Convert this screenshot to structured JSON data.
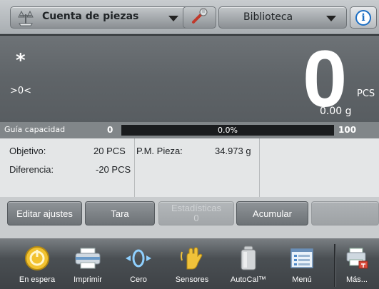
{
  "topbar": {
    "app_label": "Cuenta de piezas",
    "library_label": "Biblioteca",
    "app_icon": "scale-pieces-icon",
    "tools_icon": "wrench-icon",
    "info_icon": "info-icon",
    "info_glyph": "i"
  },
  "display": {
    "stable_indicator": "*",
    "center_zero_indicator": ">0<",
    "value": "0",
    "unit": "PCS",
    "reference_weight": "0.00 g"
  },
  "capacity": {
    "label": "Guía capacidad",
    "min": "0",
    "percent_text": "0.0%",
    "fill_fraction": 0.0,
    "max": "100"
  },
  "info": {
    "target_label": "Objetivo:",
    "target_value": "20 PCS",
    "difference_label": "Diferencia:",
    "difference_value": "-20 PCS",
    "apw_label": "P.M. Pieza:",
    "apw_value": "34.973 g"
  },
  "softkeys": {
    "edit": "Editar ajustes",
    "tare": "Tara",
    "stats_label": "Estadísticas",
    "stats_count": "0",
    "accumulate": "Acumular"
  },
  "nav": [
    {
      "label": "En espera",
      "icon": "standby-icon"
    },
    {
      "label": "Imprimir",
      "icon": "printer-icon"
    },
    {
      "label": "Cero",
      "icon": "zero-icon"
    },
    {
      "label": "Sensores",
      "icon": "hand-sensor-icon"
    },
    {
      "label": "AutoCal™",
      "icon": "calibration-weight-icon"
    },
    {
      "label": "Menú",
      "icon": "menu-list-icon"
    },
    {
      "label": "Más...",
      "icon": "more-icon"
    }
  ],
  "colors": {
    "accent_blue": "#1d6fc4",
    "capacity_fill": "#3b8c3b",
    "standby_yellow": "#f2c230"
  }
}
